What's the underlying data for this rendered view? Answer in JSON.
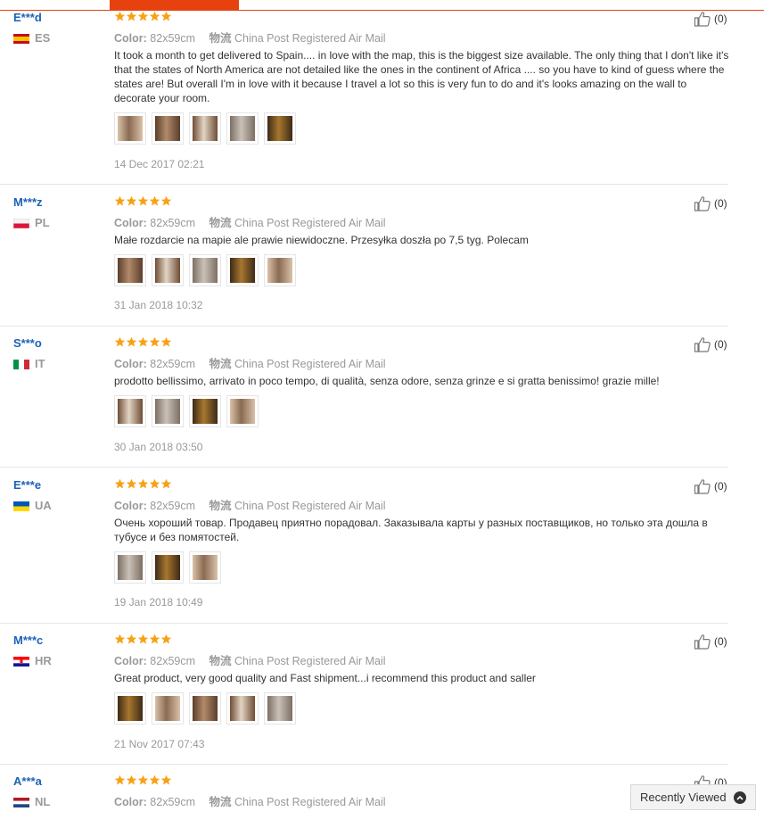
{
  "colors": {
    "accent": "#e7410f",
    "username": "#1b62b6",
    "star": "#f7a215",
    "muted": "#999999"
  },
  "labels": {
    "color_label": "Color:",
    "shipping_label": "物流",
    "recently_viewed": "Recently Viewed"
  },
  "reviews": [
    {
      "user": "E***d",
      "country": "ES",
      "flag": "spain",
      "rating": 5,
      "color": "82x59cm",
      "shipping": "China Post Registered Air Mail",
      "text": "It took a month to get delivered to Spain.... in love with the map, this is the biggest size available. The only thing that I don't like it's that the states of North America are not detailed like the ones in the continent of Africa .... so you have to kind of guess where the states are! But overall I'm in love with it because I travel a lot so this is very fun to do and it's looks amazing on the wall to decorate your room.",
      "photos": 5,
      "date": "14 Dec 2017 02:21",
      "helpful": "(0)"
    },
    {
      "user": "M***z",
      "country": "PL",
      "flag": "poland",
      "rating": 5,
      "color": "82x59cm",
      "shipping": "China Post Registered Air Mail",
      "text": "Małe rozdarcie na mapie ale prawie niewidoczne. Przesyłka doszła po 7,5 tyg. Polecam",
      "photos": 5,
      "date": "31 Jan 2018 10:32",
      "helpful": "(0)"
    },
    {
      "user": "S***o",
      "country": "IT",
      "flag": "italy",
      "rating": 5,
      "color": "82x59cm",
      "shipping": "China Post Registered Air Mail",
      "text": "prodotto bellissimo, arrivato in poco tempo, di qualità, senza odore, senza grinze e si gratta benissimo! grazie mille!",
      "photos": 4,
      "date": "30 Jan 2018 03:50",
      "helpful": "(0)"
    },
    {
      "user": "E***e",
      "country": "UA",
      "flag": "ukraine",
      "rating": 5,
      "color": "82x59cm",
      "shipping": "China Post Registered Air Mail",
      "text": "Очень хороший товар. Продавец приятно порадовал. Заказывала карты у разных поставщиков, но только эта дошла в тубусе и без помятостей.",
      "photos": 3,
      "date": "19 Jan 2018 10:49",
      "helpful": "(0)"
    },
    {
      "user": "M***c",
      "country": "HR",
      "flag": "croatia",
      "rating": 5,
      "color": "82x59cm",
      "shipping": "China Post Registered Air Mail",
      "text": "Great product, very good quality and Fast shipment...i recommend this product and saller",
      "photos": 5,
      "date": "21 Nov 2017 07:43",
      "helpful": "(0)"
    },
    {
      "user": "A***a",
      "country": "NL",
      "flag": "netherlands",
      "rating": 5,
      "color": "82x59cm",
      "shipping": "China Post Registered Air Mail",
      "text": "",
      "photos": 0,
      "date": "",
      "helpful": "(0)"
    }
  ]
}
